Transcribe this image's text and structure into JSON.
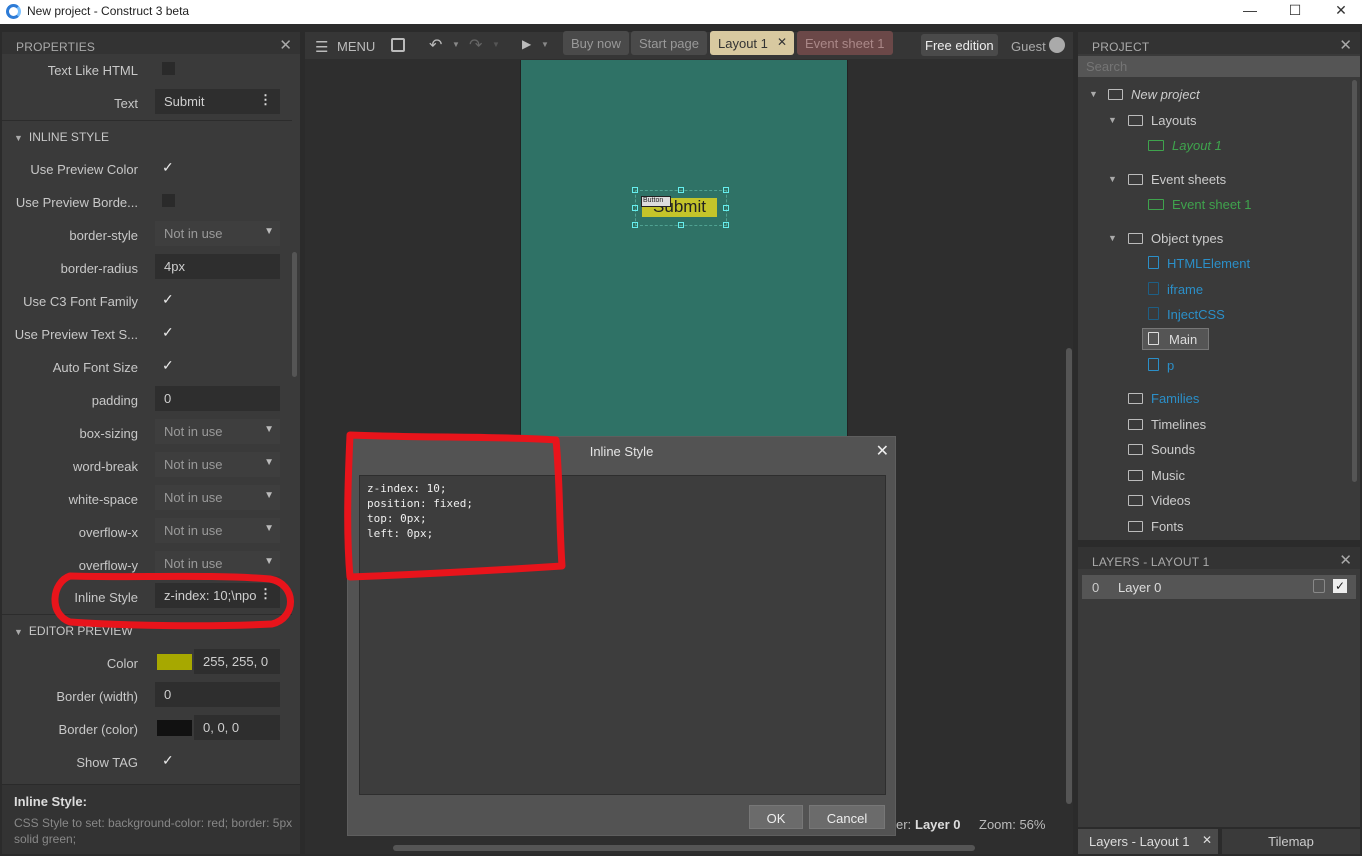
{
  "window": {
    "title": "New project - Construct 3 beta",
    "minimize": "—",
    "maximize": "☐",
    "close": "✕"
  },
  "properties": {
    "header": "PROPERTIES",
    "rows_top": [
      {
        "label": "Text Like HTML",
        "checked": false
      },
      {
        "label": "Text",
        "value": "Submit"
      }
    ],
    "inline_style_section": "INLINE STYLE",
    "inline_rows": [
      {
        "label": "Use Preview Color",
        "type": "check",
        "checked": true
      },
      {
        "label": "Use Preview Borde...",
        "type": "check",
        "checked": false
      },
      {
        "label": "border-style",
        "type": "select",
        "value": "Not in use"
      },
      {
        "label": "border-radius",
        "type": "text",
        "value": "4px"
      },
      {
        "label": "Use C3 Font Family",
        "type": "check",
        "checked": true
      },
      {
        "label": "Use Preview Text S...",
        "type": "check",
        "checked": true
      },
      {
        "label": "Auto Font Size",
        "type": "check",
        "checked": true
      },
      {
        "label": "padding",
        "type": "text",
        "value": "0"
      },
      {
        "label": "box-sizing",
        "type": "select",
        "value": "Not in use"
      },
      {
        "label": "word-break",
        "type": "select",
        "value": "Not in use"
      },
      {
        "label": "white-space",
        "type": "select",
        "value": "Not in use"
      },
      {
        "label": "overflow-x",
        "type": "select",
        "value": "Not in use"
      },
      {
        "label": "overflow-y",
        "type": "select",
        "value": "Not in use"
      }
    ],
    "inline_style": {
      "label": "Inline Style",
      "value": "z-index: 10;\\npo"
    },
    "editor_preview_section": "EDITOR PREVIEW",
    "preview_rows": [
      {
        "label": "Color",
        "swatch": "#a7a800",
        "value": "255, 255, 0"
      },
      {
        "label": "Border (width)",
        "value": "0"
      },
      {
        "label": "Border (color)",
        "swatch": "#111111",
        "value": "0, 0, 0"
      },
      {
        "label": "Show TAG",
        "checked": true
      }
    ],
    "help_title": "Inline Style:",
    "help_text": "CSS Style to set: background-color: red; border: 5px solid green;"
  },
  "toolbar": {
    "menu": "MENU",
    "tabs": [
      "Buy now",
      "Start page",
      "Layout 1",
      "Event sheet 1"
    ],
    "free_edition": "Free edition",
    "guest": "Guest"
  },
  "layout": {
    "button_text": "Submit",
    "tag_text": "Button",
    "status_layer_prefix": "er:",
    "status_layer": "Layer 0",
    "zoom": "Zoom: 56%"
  },
  "dialog": {
    "title": "Inline Style",
    "content": "z-index: 10;\nposition: fixed;\ntop: 0px;\nleft: 0px;",
    "ok": "OK",
    "cancel": "Cancel"
  },
  "project": {
    "header": "PROJECT",
    "search_placeholder": "Search",
    "items": {
      "root": "New project",
      "layouts": "Layouts",
      "layout1": "Layout 1",
      "event_sheets": "Event sheets",
      "event_sheet1": "Event sheet 1",
      "object_types": "Object types",
      "obj1": "HTMLElement",
      "obj2": "iframe",
      "obj3": "InjectCSS",
      "obj4": "Main",
      "obj5": "p",
      "families": "Families",
      "timelines": "Timelines",
      "sounds": "Sounds",
      "music": "Music",
      "videos": "Videos",
      "fonts": "Fonts"
    }
  },
  "layers": {
    "header": "LAYERS - LAYOUT 1",
    "row_index": "0",
    "row_name": "Layer 0",
    "bottom_tabs": [
      "Layers - Layout 1",
      "Tilemap"
    ]
  },
  "colors": {
    "accent": "#2f7266",
    "annotation": "#e8141b",
    "tab_active": "#d8c9a0"
  }
}
